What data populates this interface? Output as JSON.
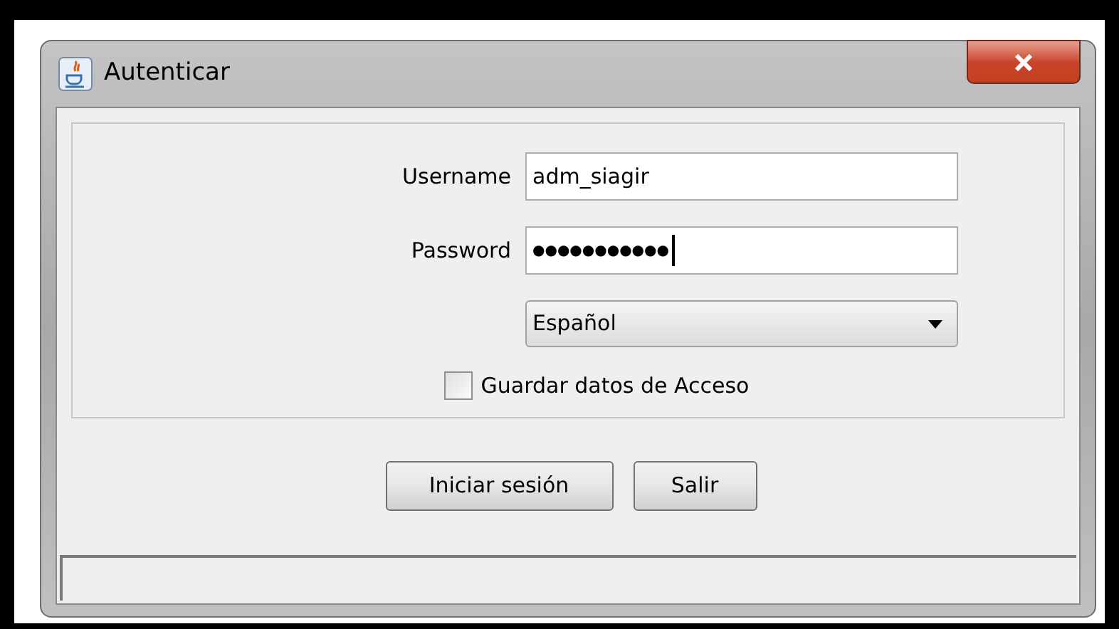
{
  "window": {
    "title": "Autenticar"
  },
  "form": {
    "username": {
      "label": "Username",
      "value": "adm_siagir"
    },
    "password": {
      "label": "Password",
      "value": "●●●●●●●●●●●",
      "focused": true
    },
    "language": {
      "value": "Español"
    },
    "remember": {
      "label": "Guardar datos de Acceso",
      "checked": false
    }
  },
  "buttons": [
    {
      "label": "Iniciar sesión"
    },
    {
      "label": "Salir"
    }
  ]
}
